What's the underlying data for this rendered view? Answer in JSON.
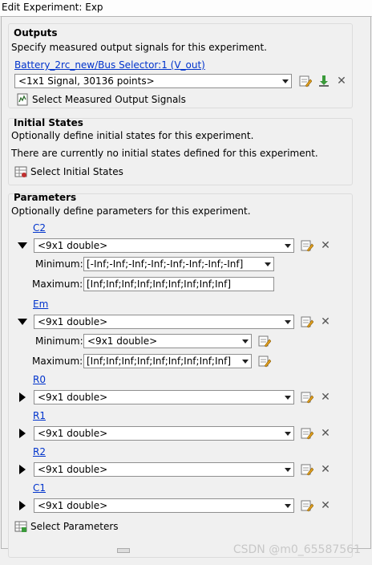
{
  "window": {
    "title": "Edit Experiment: Exp"
  },
  "outputs": {
    "title": "Outputs",
    "description": "Specify measured output signals for this experiment.",
    "signal_link": "Battery_2rc_new/Bus Selector:1 (V_out)",
    "signal_value": "<1x1 Signal, 30136 points>",
    "select_button": "Select Measured Output Signals"
  },
  "initial_states": {
    "title": "Initial States",
    "description": "Optionally define initial states for this experiment.",
    "status": "There are currently no initial states defined for this experiment.",
    "select_button": "Select Initial States"
  },
  "parameters": {
    "title": "Parameters",
    "description": "Optionally define parameters for this experiment.",
    "minimum_label": "Minimum:",
    "maximum_label": "Maximum:",
    "items": [
      {
        "name": "C2",
        "value": "<9x1 double>",
        "expanded": true,
        "minimum": "[-Inf;-Inf;-Inf;-Inf;-Inf;-Inf;-Inf;-Inf]",
        "maximum": "[Inf;Inf;Inf;Inf;Inf;Inf;Inf;Inf;Inf]"
      },
      {
        "name": "Em",
        "value": "<9x1 double>",
        "expanded": true,
        "minimum": "<9x1 double>",
        "maximum": "[Inf;Inf;Inf;Inf;Inf;Inf;Inf;Inf;Inf]"
      },
      {
        "name": "R0",
        "value": "<9x1 double>",
        "expanded": false
      },
      {
        "name": "R1",
        "value": "<9x1 double>",
        "expanded": false
      },
      {
        "name": "R2",
        "value": "<9x1 double>",
        "expanded": false
      },
      {
        "name": "C1",
        "value": "<9x1 double>",
        "expanded": false
      }
    ],
    "select_button": "Select Parameters"
  },
  "watermark": "CSDN @m0_65587561"
}
